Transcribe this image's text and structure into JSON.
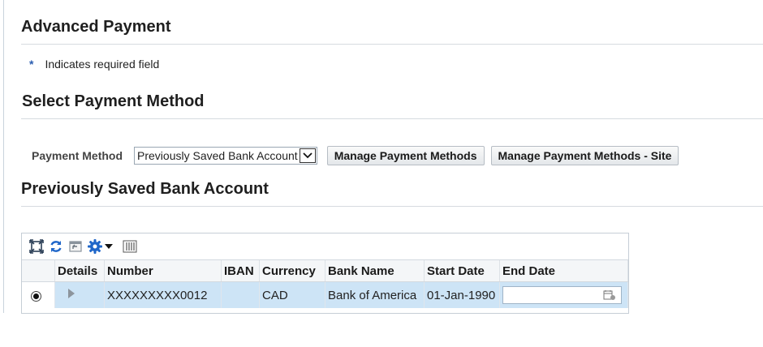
{
  "page": {
    "title": "Advanced Payment",
    "required_star": "*",
    "required_note": "Indicates required field"
  },
  "select_section": {
    "title": "Select Payment Method",
    "method_label": "Payment Method",
    "method_value": "Previously Saved Bank Account",
    "buttons": {
      "manage": "Manage Payment Methods",
      "manage_site": "Manage Payment Methods - Site"
    }
  },
  "saved_section": {
    "title": "Previously Saved Bank Account",
    "toolbar_icons": [
      "detach-icon",
      "refresh-icon",
      "restore-icon",
      "gear-icon",
      "dropdown-arrow-icon",
      "columns-icon"
    ],
    "table": {
      "columns": [
        "",
        "Details",
        "Number",
        "IBAN",
        "Currency",
        "Bank Name",
        "Start Date",
        "End Date"
      ],
      "rows": [
        {
          "selected": true,
          "number": "XXXXXXXXX0012",
          "iban": "",
          "currency": "CAD",
          "bank_name": "Bank of America",
          "start_date": "01-Jan-1990",
          "end_date": ""
        }
      ]
    }
  },
  "colors": {
    "selected_row": "#cde4f6",
    "required_star": "#2a5db0",
    "gear_icon": "#1f66c9"
  }
}
